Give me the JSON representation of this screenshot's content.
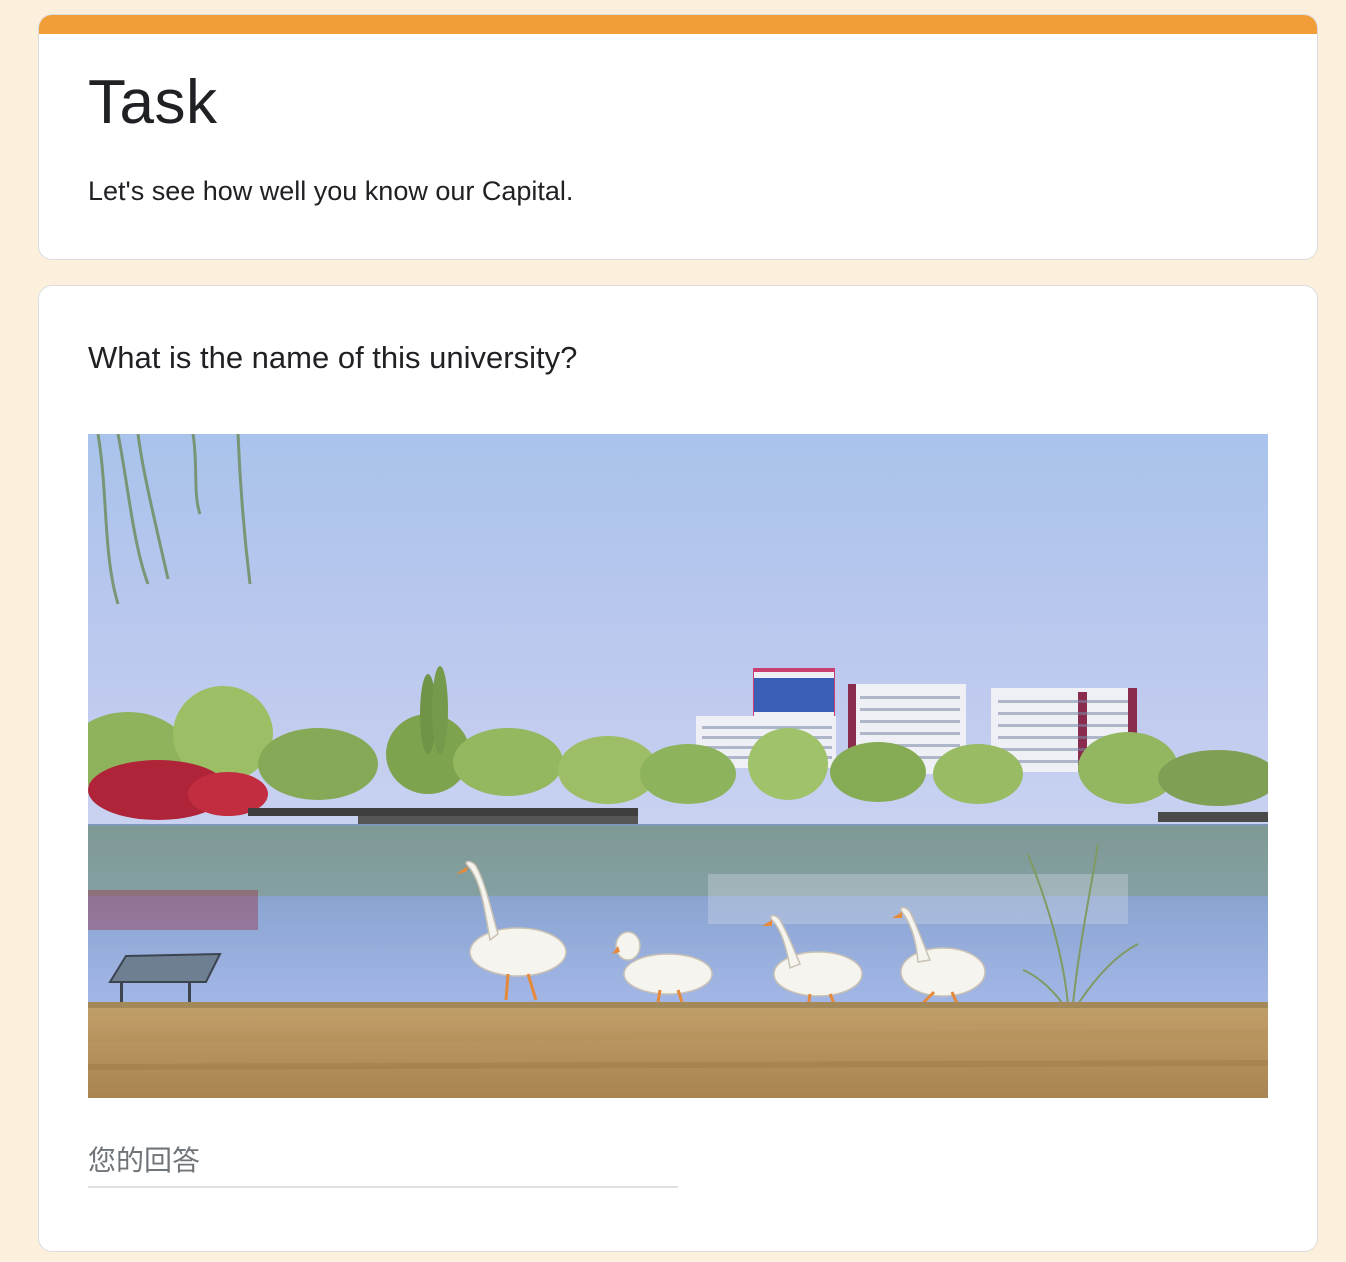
{
  "header": {
    "title": "Task",
    "description": "Let's see how well you know our Capital.",
    "accent_color": "#f29e38"
  },
  "question": {
    "title": "What is the name of this university?",
    "image_subject": "photo of white geese walking along a campus lakeshore with university buildings in the background",
    "answer_placeholder": "您的回答",
    "answer_value": ""
  },
  "colors": {
    "page_background": "#fcf0dc",
    "card_background": "#ffffff",
    "card_border": "#dadce0",
    "text_primary": "#202124",
    "text_placeholder": "#70757a"
  }
}
